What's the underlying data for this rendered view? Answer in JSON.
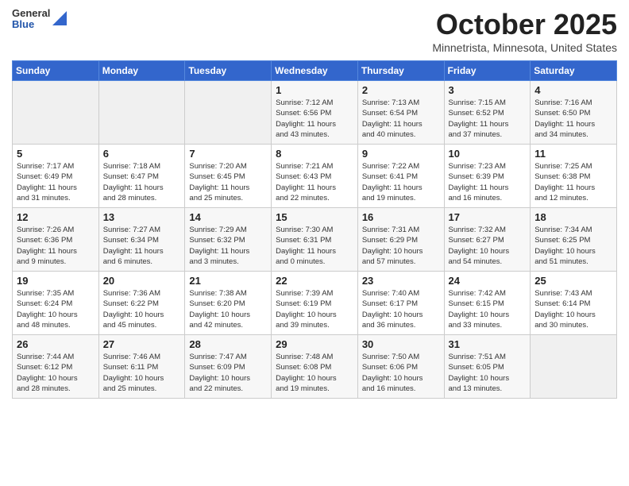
{
  "header": {
    "logo": {
      "general": "General",
      "blue": "Blue"
    },
    "title": "October 2025",
    "location": "Minnetrista, Minnesota, United States"
  },
  "days_of_week": [
    "Sunday",
    "Monday",
    "Tuesday",
    "Wednesday",
    "Thursday",
    "Friday",
    "Saturday"
  ],
  "weeks": [
    [
      {
        "day": null,
        "info": null
      },
      {
        "day": null,
        "info": null
      },
      {
        "day": null,
        "info": null
      },
      {
        "day": "1",
        "info": "Sunrise: 7:12 AM\nSunset: 6:56 PM\nDaylight: 11 hours\nand 43 minutes."
      },
      {
        "day": "2",
        "info": "Sunrise: 7:13 AM\nSunset: 6:54 PM\nDaylight: 11 hours\nand 40 minutes."
      },
      {
        "day": "3",
        "info": "Sunrise: 7:15 AM\nSunset: 6:52 PM\nDaylight: 11 hours\nand 37 minutes."
      },
      {
        "day": "4",
        "info": "Sunrise: 7:16 AM\nSunset: 6:50 PM\nDaylight: 11 hours\nand 34 minutes."
      }
    ],
    [
      {
        "day": "5",
        "info": "Sunrise: 7:17 AM\nSunset: 6:49 PM\nDaylight: 11 hours\nand 31 minutes."
      },
      {
        "day": "6",
        "info": "Sunrise: 7:18 AM\nSunset: 6:47 PM\nDaylight: 11 hours\nand 28 minutes."
      },
      {
        "day": "7",
        "info": "Sunrise: 7:20 AM\nSunset: 6:45 PM\nDaylight: 11 hours\nand 25 minutes."
      },
      {
        "day": "8",
        "info": "Sunrise: 7:21 AM\nSunset: 6:43 PM\nDaylight: 11 hours\nand 22 minutes."
      },
      {
        "day": "9",
        "info": "Sunrise: 7:22 AM\nSunset: 6:41 PM\nDaylight: 11 hours\nand 19 minutes."
      },
      {
        "day": "10",
        "info": "Sunrise: 7:23 AM\nSunset: 6:39 PM\nDaylight: 11 hours\nand 16 minutes."
      },
      {
        "day": "11",
        "info": "Sunrise: 7:25 AM\nSunset: 6:38 PM\nDaylight: 11 hours\nand 12 minutes."
      }
    ],
    [
      {
        "day": "12",
        "info": "Sunrise: 7:26 AM\nSunset: 6:36 PM\nDaylight: 11 hours\nand 9 minutes."
      },
      {
        "day": "13",
        "info": "Sunrise: 7:27 AM\nSunset: 6:34 PM\nDaylight: 11 hours\nand 6 minutes."
      },
      {
        "day": "14",
        "info": "Sunrise: 7:29 AM\nSunset: 6:32 PM\nDaylight: 11 hours\nand 3 minutes."
      },
      {
        "day": "15",
        "info": "Sunrise: 7:30 AM\nSunset: 6:31 PM\nDaylight: 11 hours\nand 0 minutes."
      },
      {
        "day": "16",
        "info": "Sunrise: 7:31 AM\nSunset: 6:29 PM\nDaylight: 10 hours\nand 57 minutes."
      },
      {
        "day": "17",
        "info": "Sunrise: 7:32 AM\nSunset: 6:27 PM\nDaylight: 10 hours\nand 54 minutes."
      },
      {
        "day": "18",
        "info": "Sunrise: 7:34 AM\nSunset: 6:25 PM\nDaylight: 10 hours\nand 51 minutes."
      }
    ],
    [
      {
        "day": "19",
        "info": "Sunrise: 7:35 AM\nSunset: 6:24 PM\nDaylight: 10 hours\nand 48 minutes."
      },
      {
        "day": "20",
        "info": "Sunrise: 7:36 AM\nSunset: 6:22 PM\nDaylight: 10 hours\nand 45 minutes."
      },
      {
        "day": "21",
        "info": "Sunrise: 7:38 AM\nSunset: 6:20 PM\nDaylight: 10 hours\nand 42 minutes."
      },
      {
        "day": "22",
        "info": "Sunrise: 7:39 AM\nSunset: 6:19 PM\nDaylight: 10 hours\nand 39 minutes."
      },
      {
        "day": "23",
        "info": "Sunrise: 7:40 AM\nSunset: 6:17 PM\nDaylight: 10 hours\nand 36 minutes."
      },
      {
        "day": "24",
        "info": "Sunrise: 7:42 AM\nSunset: 6:15 PM\nDaylight: 10 hours\nand 33 minutes."
      },
      {
        "day": "25",
        "info": "Sunrise: 7:43 AM\nSunset: 6:14 PM\nDaylight: 10 hours\nand 30 minutes."
      }
    ],
    [
      {
        "day": "26",
        "info": "Sunrise: 7:44 AM\nSunset: 6:12 PM\nDaylight: 10 hours\nand 28 minutes."
      },
      {
        "day": "27",
        "info": "Sunrise: 7:46 AM\nSunset: 6:11 PM\nDaylight: 10 hours\nand 25 minutes."
      },
      {
        "day": "28",
        "info": "Sunrise: 7:47 AM\nSunset: 6:09 PM\nDaylight: 10 hours\nand 22 minutes."
      },
      {
        "day": "29",
        "info": "Sunrise: 7:48 AM\nSunset: 6:08 PM\nDaylight: 10 hours\nand 19 minutes."
      },
      {
        "day": "30",
        "info": "Sunrise: 7:50 AM\nSunset: 6:06 PM\nDaylight: 10 hours\nand 16 minutes."
      },
      {
        "day": "31",
        "info": "Sunrise: 7:51 AM\nSunset: 6:05 PM\nDaylight: 10 hours\nand 13 minutes."
      },
      {
        "day": null,
        "info": null
      }
    ]
  ]
}
